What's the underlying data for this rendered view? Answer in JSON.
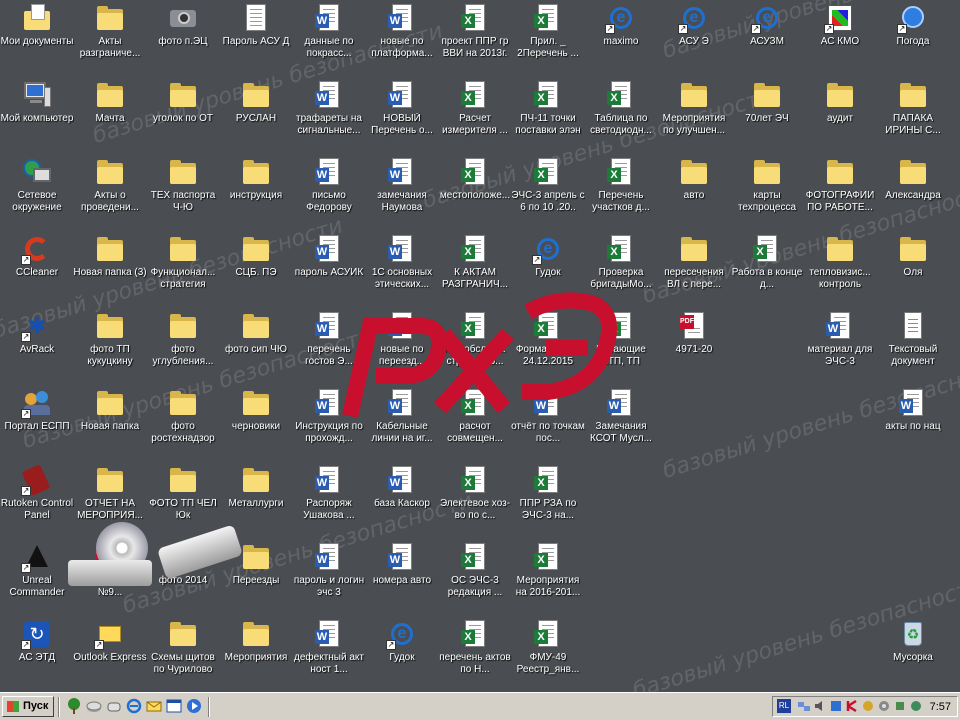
{
  "watermark_text": "базовый уровень безопасности",
  "logo": {
    "brand_color": "#c8102e"
  },
  "desktop": {
    "icons": [
      {
        "id": "i01",
        "col": 0,
        "row": 0,
        "type": "mydocs",
        "label": "Мои документы",
        "shortcut": false
      },
      {
        "id": "i02",
        "col": 0,
        "row": 1,
        "type": "pc",
        "label": "Мой компьютер",
        "shortcut": false
      },
      {
        "id": "i03",
        "col": 0,
        "row": 2,
        "type": "net",
        "label": "Сетевое окружение",
        "shortcut": false
      },
      {
        "id": "i04",
        "col": 0,
        "row": 3,
        "type": "ccleaner",
        "label": "CCleaner",
        "shortcut": true
      },
      {
        "id": "i05",
        "col": 0,
        "row": 4,
        "type": "avrack",
        "label": "AvRack",
        "shortcut": true
      },
      {
        "id": "i06",
        "col": 0,
        "row": 5,
        "type": "portal",
        "label": "Портал ЕСПП",
        "shortcut": true
      },
      {
        "id": "i07",
        "col": 0,
        "row": 6,
        "type": "rutoken",
        "label": "Rutoken Control Panel",
        "shortcut": true
      },
      {
        "id": "i08",
        "col": 0,
        "row": 7,
        "type": "unreal",
        "label": "Unreal Commander",
        "shortcut": true
      },
      {
        "id": "i09",
        "col": 0,
        "row": 8,
        "type": "asetd",
        "label": "АС ЭТД",
        "shortcut": true
      },
      {
        "id": "i10",
        "col": 1,
        "row": 0,
        "type": "folder",
        "label": "Акты разграниче...",
        "shortcut": false
      },
      {
        "id": "i11",
        "col": 1,
        "row": 1,
        "type": "folder",
        "label": "Мачта",
        "shortcut": false
      },
      {
        "id": "i12",
        "col": 1,
        "row": 2,
        "type": "folder",
        "label": "Акты о проведени...",
        "shortcut": false
      },
      {
        "id": "i13",
        "col": 1,
        "row": 3,
        "type": "folder",
        "label": "Новая папка (3)",
        "shortcut": false
      },
      {
        "id": "i14",
        "col": 1,
        "row": 4,
        "type": "folder",
        "label": "фото ТП кукуцкину",
        "shortcut": false
      },
      {
        "id": "i15",
        "col": 1,
        "row": 5,
        "type": "folder",
        "label": "Новая папка",
        "shortcut": false
      },
      {
        "id": "i16",
        "col": 1,
        "row": 6,
        "type": "folder",
        "label": "ОТЧЕТ НА МЕРОПРИЯ...",
        "shortcut": false
      },
      {
        "id": "i17",
        "col": 1,
        "row": 7,
        "type": "pdf",
        "label": "Счет на оплату №9...",
        "shortcut": false
      },
      {
        "id": "i18",
        "col": 1,
        "row": 8,
        "type": "outlook",
        "label": "Outlook Express",
        "shortcut": true
      },
      {
        "id": "i19",
        "col": 2,
        "row": 0,
        "type": "camera",
        "label": "фото п.ЭЦ",
        "shortcut": false
      },
      {
        "id": "i20",
        "col": 2,
        "row": 1,
        "type": "folder",
        "label": "уголок по ОТ",
        "shortcut": false
      },
      {
        "id": "i21",
        "col": 2,
        "row": 2,
        "type": "folder",
        "label": "ТЕХ паспорта Ч-Ю",
        "shortcut": false
      },
      {
        "id": "i22",
        "col": 2,
        "row": 3,
        "type": "folder",
        "label": "Функционал... стратегия",
        "shortcut": false
      },
      {
        "id": "i23",
        "col": 2,
        "row": 4,
        "type": "folder",
        "label": "фото углубления...",
        "shortcut": false
      },
      {
        "id": "i24",
        "col": 2,
        "row": 5,
        "type": "folder",
        "label": "фото ростехнадзор",
        "shortcut": false
      },
      {
        "id": "i25",
        "col": 2,
        "row": 6,
        "type": "folder",
        "label": "ФОТО ТП ЧЕЛ Юк",
        "shortcut": false
      },
      {
        "id": "i26",
        "col": 2,
        "row": 7,
        "type": "folder",
        "label": "фото 2014",
        "shortcut": false
      },
      {
        "id": "i27",
        "col": 2,
        "row": 8,
        "type": "folder",
        "label": "Схемы щитов по Чурилово",
        "shortcut": false
      },
      {
        "id": "i28",
        "col": 3,
        "row": 0,
        "type": "txt",
        "label": "Пароль АСУ Д",
        "shortcut": false
      },
      {
        "id": "i29",
        "col": 3,
        "row": 1,
        "type": "folder",
        "label": "РУСЛАН",
        "shortcut": false
      },
      {
        "id": "i30",
        "col": 3,
        "row": 2,
        "type": "folder",
        "label": "инструкция",
        "shortcut": false
      },
      {
        "id": "i31",
        "col": 3,
        "row": 3,
        "type": "folder",
        "label": "СЦБ. ПЭ",
        "shortcut": false
      },
      {
        "id": "i32",
        "col": 3,
        "row": 4,
        "type": "folder",
        "label": "фото сип ЧЮ",
        "shortcut": false
      },
      {
        "id": "i33",
        "col": 3,
        "row": 5,
        "type": "folder",
        "label": "черновики",
        "shortcut": false
      },
      {
        "id": "i34",
        "col": 3,
        "row": 6,
        "type": "folder",
        "label": "Металлурги",
        "shortcut": false
      },
      {
        "id": "i35",
        "col": 3,
        "row": 7,
        "type": "folder",
        "label": "Переезды",
        "shortcut": false
      },
      {
        "id": "i36",
        "col": 3,
        "row": 8,
        "type": "folder",
        "label": "Мероприятия",
        "shortcut": false
      },
      {
        "id": "i37",
        "col": 4,
        "row": 0,
        "type": "word",
        "label": "данные по покрасс...",
        "shortcut": false
      },
      {
        "id": "i38",
        "col": 4,
        "row": 1,
        "type": "word",
        "label": "трафареты на сигнальные...",
        "shortcut": false
      },
      {
        "id": "i39",
        "col": 4,
        "row": 2,
        "type": "word",
        "label": "письмо Федорову",
        "shortcut": false
      },
      {
        "id": "i40",
        "col": 4,
        "row": 3,
        "type": "word",
        "label": "пароль АСУИК",
        "shortcut": false
      },
      {
        "id": "i41",
        "col": 4,
        "row": 4,
        "type": "word",
        "label": "перечень гостов Э...",
        "shortcut": false
      },
      {
        "id": "i42",
        "col": 4,
        "row": 5,
        "type": "word",
        "label": "Инструкция по прохожд...",
        "shortcut": false
      },
      {
        "id": "i43",
        "col": 4,
        "row": 6,
        "type": "word",
        "label": "Распоряж Ушакова ...",
        "shortcut": false
      },
      {
        "id": "i44",
        "col": 4,
        "row": 7,
        "type": "word",
        "label": "пароль и логин эчс 3",
        "shortcut": false
      },
      {
        "id": "i45",
        "col": 4,
        "row": 8,
        "type": "word",
        "label": "дефектный акт ност 1...",
        "shortcut": false
      },
      {
        "id": "i46",
        "col": 5,
        "row": 0,
        "type": "word",
        "label": "новые по платформа...",
        "shortcut": false
      },
      {
        "id": "i47",
        "col": 5,
        "row": 1,
        "type": "word",
        "label": "НОВЫЙ Перечень о...",
        "shortcut": false
      },
      {
        "id": "i48",
        "col": 5,
        "row": 2,
        "type": "word",
        "label": "замечания Наумова",
        "shortcut": false
      },
      {
        "id": "i49",
        "col": 5,
        "row": 3,
        "type": "word",
        "label": "1С основных этических...",
        "shortcut": false
      },
      {
        "id": "i50",
        "col": 5,
        "row": 4,
        "type": "word",
        "label": "новые по переезд...",
        "shortcut": false
      },
      {
        "id": "i51",
        "col": 5,
        "row": 5,
        "type": "word",
        "label": "Кабельные линии на иг...",
        "shortcut": false
      },
      {
        "id": "i52",
        "col": 5,
        "row": 6,
        "type": "word",
        "label": "база Каскор",
        "shortcut": false
      },
      {
        "id": "i53",
        "col": 5,
        "row": 7,
        "type": "word",
        "label": "номера авто",
        "shortcut": false
      },
      {
        "id": "i54",
        "col": 5,
        "row": 8,
        "type": "ie",
        "label": "Гудок",
        "shortcut": true
      },
      {
        "id": "i55",
        "col": 6,
        "row": 0,
        "type": "excel",
        "label": "проект ППР гр ВВИ на 2013г.",
        "shortcut": false
      },
      {
        "id": "i56",
        "col": 6,
        "row": 1,
        "type": "excel",
        "label": "Расчет измерителя ...",
        "shortcut": false
      },
      {
        "id": "i57",
        "col": 6,
        "row": 2,
        "type": "excel",
        "label": "местоположе...",
        "shortcut": false
      },
      {
        "id": "i58",
        "col": 6,
        "row": 3,
        "type": "excel",
        "label": "К АКТАМ РАЗГРАНИЧ...",
        "shortcut": false
      },
      {
        "id": "i59",
        "col": 6,
        "row": 4,
        "type": "excel",
        "label": "п17-обслед... струк.урно...",
        "shortcut": false
      },
      {
        "id": "i60",
        "col": 6,
        "row": 5,
        "type": "excel",
        "label": "расчот совмещен...",
        "shortcut": false
      },
      {
        "id": "i61",
        "col": 6,
        "row": 6,
        "type": "excel",
        "label": "Электевое хоз-во по с...",
        "shortcut": false
      },
      {
        "id": "i62",
        "col": 6,
        "row": 7,
        "type": "excel",
        "label": "ОС ЭЧС-3 редакция ...",
        "shortcut": false
      },
      {
        "id": "i63",
        "col": 6,
        "row": 8,
        "type": "excel",
        "label": "перечень актов по Н...",
        "shortcut": false
      },
      {
        "id": "i64",
        "col": 7,
        "row": 0,
        "type": "excel",
        "label": "Прил. _ 2Перечень ...",
        "shortcut": false
      },
      {
        "id": "i65",
        "col": 7,
        "row": 1,
        "type": "excel",
        "label": "ПЧ-11 точки поставки элэн",
        "shortcut": false
      },
      {
        "id": "i66",
        "col": 7,
        "row": 2,
        "type": "excel",
        "label": "ЭЧС-3 апрель с 6 по 10 .20..",
        "shortcut": false
      },
      {
        "id": "i67",
        "col": 7,
        "row": 3,
        "type": "ie",
        "label": "Гудок",
        "shortcut": true
      },
      {
        "id": "i68",
        "col": 7,
        "row": 4,
        "type": "excel",
        "label": "Форма отчета 24.12.2015",
        "shortcut": false
      },
      {
        "id": "i69",
        "col": 7,
        "row": 5,
        "type": "word",
        "label": "отчёт по точкам пос...",
        "shortcut": false
      },
      {
        "id": "i70",
        "col": 7,
        "row": 6,
        "type": "excel",
        "label": "ППР РЗА по ЭЧС-3 на...",
        "shortcut": false
      },
      {
        "id": "i71",
        "col": 7,
        "row": 7,
        "type": "excel",
        "label": "Мероприятия на 2016-201...",
        "shortcut": false
      },
      {
        "id": "i72",
        "col": 7,
        "row": 8,
        "type": "excel",
        "label": "ФМУ-49 Реестр_янв...",
        "shortcut": false
      },
      {
        "id": "i73",
        "col": 8,
        "row": 0,
        "type": "ie",
        "label": "maximo",
        "shortcut": true
      },
      {
        "id": "i74",
        "col": 8,
        "row": 1,
        "type": "excel",
        "label": "Таблица по светодиодн...",
        "shortcut": false
      },
      {
        "id": "i75",
        "col": 8,
        "row": 2,
        "type": "excel",
        "label": "Перечень участков д...",
        "shortcut": false
      },
      {
        "id": "i76",
        "col": 8,
        "row": 3,
        "type": "excel",
        "label": "Проверка бригадыМо...",
        "shortcut": false
      },
      {
        "id": "i77",
        "col": 8,
        "row": 4,
        "type": "excel",
        "label": "Питающие КТП, ТП",
        "shortcut": false
      },
      {
        "id": "i78",
        "col": 8,
        "row": 5,
        "type": "word",
        "label": "Замечания КСОТ Мусл...",
        "shortcut": false
      },
      {
        "id": "i79",
        "col": 9,
        "row": 0,
        "type": "ie",
        "label": "АСУ Э",
        "shortcut": true
      },
      {
        "id": "i80",
        "col": 9,
        "row": 1,
        "type": "folder",
        "label": "Мероприятия по улучшен...",
        "shortcut": false
      },
      {
        "id": "i81",
        "col": 9,
        "row": 2,
        "type": "folder",
        "label": "авто",
        "shortcut": false
      },
      {
        "id": "i82",
        "col": 9,
        "row": 3,
        "type": "folder",
        "label": "пересечения ВЛ с пере...",
        "shortcut": false
      },
      {
        "id": "i83",
        "col": 9,
        "row": 4,
        "type": "pdf",
        "label": "4971-20",
        "shortcut": false
      },
      {
        "id": "i84",
        "col": 10,
        "row": 0,
        "type": "ie",
        "label": "АСУЗМ",
        "shortcut": true
      },
      {
        "id": "i85",
        "col": 10,
        "row": 1,
        "type": "folder",
        "label": "70лет ЭЧ",
        "shortcut": false
      },
      {
        "id": "i86",
        "col": 10,
        "row": 2,
        "type": "folder",
        "label": "карты техпроцесса",
        "shortcut": false
      },
      {
        "id": "i87",
        "col": 10,
        "row": 3,
        "type": "excel",
        "label": "Работа в конце д...",
        "shortcut": false
      },
      {
        "id": "i88",
        "col": 11,
        "row": 0,
        "type": "kmo",
        "label": "АС КМО",
        "shortcut": true
      },
      {
        "id": "i89",
        "col": 11,
        "row": 1,
        "type": "folder",
        "label": "аудит",
        "shortcut": false
      },
      {
        "id": "i90",
        "col": 11,
        "row": 2,
        "type": "folder",
        "label": "ФОТОГРАФИИ ПО РАБОТЕ...",
        "shortcut": false
      },
      {
        "id": "i91",
        "col": 11,
        "row": 3,
        "type": "folder",
        "label": "тепловизис... контроль",
        "shortcut": false
      },
      {
        "id": "i92",
        "col": 11,
        "row": 4,
        "type": "word",
        "label": "материал для ЭЧС-3",
        "shortcut": false
      },
      {
        "id": "i93",
        "col": 12,
        "row": 0,
        "type": "weather",
        "label": "Погода",
        "shortcut": true
      },
      {
        "id": "i94",
        "col": 12,
        "row": 1,
        "type": "folder",
        "label": "ПАПАКА ИРИНЫ С...",
        "shortcut": false
      },
      {
        "id": "i95",
        "col": 12,
        "row": 2,
        "type": "folder",
        "label": "Александра",
        "shortcut": false
      },
      {
        "id": "i96",
        "col": 12,
        "row": 3,
        "type": "folder",
        "label": "Оля",
        "shortcut": false
      },
      {
        "id": "i97",
        "col": 12,
        "row": 4,
        "type": "notepad",
        "label": "Текстовый документ",
        "shortcut": false
      },
      {
        "id": "i98",
        "col": 12,
        "row": 5,
        "type": "word",
        "label": "акты по нац",
        "shortcut": false
      },
      {
        "id": "i99",
        "col": 12,
        "row": 8,
        "type": "recycle",
        "label": "Мусорка",
        "shortcut": false
      }
    ]
  },
  "taskbar": {
    "start_label": "Пуск",
    "quick_launch": [
      "tree-icon",
      "disk-icon",
      "hand-icon",
      "ie-icon",
      "outlook-icon",
      "window-icon",
      "media-icon"
    ],
    "tray": {
      "language": "RL",
      "icons": [
        "network-icon",
        "sound-icon",
        "security-icon",
        "antivirus-icon",
        "update-icon",
        "disk-tray-icon",
        "power-icon",
        "monitor-icon"
      ],
      "clock": "7:57"
    }
  }
}
